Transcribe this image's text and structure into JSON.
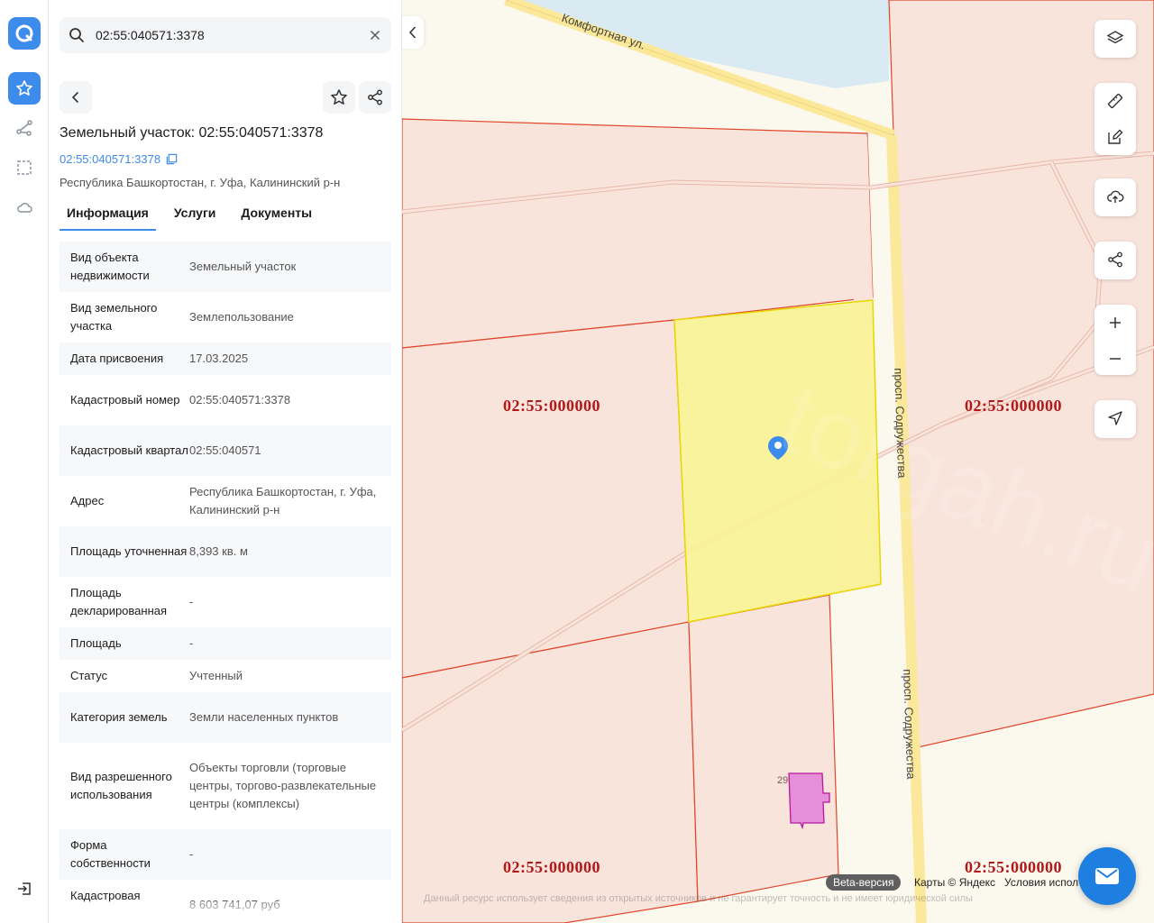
{
  "rail": {
    "items": [
      {
        "name": "favorites",
        "icon": "star-icon",
        "active": true
      },
      {
        "name": "route",
        "icon": "route-icon",
        "active": false
      },
      {
        "name": "select-area",
        "icon": "selection-icon",
        "active": false
      },
      {
        "name": "cloud",
        "icon": "cloud-icon",
        "active": false
      }
    ],
    "accent": "#3d8bea"
  },
  "search": {
    "value": "02:55:040571:3378"
  },
  "object": {
    "title": "Земельный участок: 02:55:040571:3378",
    "cad_link": "02:55:040571:3378",
    "address": "Республика Башкортостан, г. Уфа, Калининский р-н"
  },
  "tabs": [
    {
      "label": "Информация",
      "active": true
    },
    {
      "label": "Услуги",
      "active": false
    },
    {
      "label": "Документы",
      "active": false
    }
  ],
  "info_rows": [
    {
      "key": "Вид объекта недвижимости",
      "value": "Земельный участок"
    },
    {
      "key": "Вид земельного участка",
      "value": "Землепользование"
    },
    {
      "key": "Дата присвоения",
      "value": "17.03.2025"
    },
    {
      "key": "Кадастровый номер",
      "value": "02:55:040571:3378"
    },
    {
      "key": "Кадастровый квартал",
      "value": "02:55:040571"
    },
    {
      "key": "Адрес",
      "value": "Республика Башкортостан, г. Уфа, Калининский р-н"
    },
    {
      "key": "Площадь уточненная",
      "value": "8,393 кв. м"
    },
    {
      "key": "Площадь декларированная",
      "value": "-"
    },
    {
      "key": "Площадь",
      "value": "-"
    },
    {
      "key": "Статус",
      "value": "Учтенный"
    },
    {
      "key": "Категория земель",
      "value": "Земли населенных пунктов"
    },
    {
      "key": "Вид разрешенного использования",
      "value": "Объекты торговли (торговые центры, торгово-развлекательные центры (комплексы)"
    },
    {
      "key": "Форма собственности",
      "value": "-"
    },
    {
      "key": "Кадастровая",
      "value": "8 603 741,07 руб"
    }
  ],
  "map": {
    "cad_labels": [
      "02:55:000000",
      "02:55:000000",
      "02:55:000000",
      "02:55:000000"
    ],
    "streets": [
      "Комфортная ул.",
      "просп. Содружества",
      "просп. Содружества"
    ],
    "building_number": "29",
    "watermark": "torgah.ru",
    "beta_label": "Beta-версия",
    "copyright": "Карты © Яндекс",
    "terms": "Условия испол",
    "disclaimer": "Данный ресурс использует сведения из открытых источников и не гарантирует точность и не имеет юридической силы",
    "colors": {
      "parcel_fill": "#f9e4dc",
      "parcel_stroke": "#e0452a",
      "selected_fill": "#f9f296",
      "selected_stroke": "#e8d800",
      "building_fill": "#e48fd8",
      "road": "#fbe89a",
      "water": "#d9eaf2"
    }
  },
  "map_controls": [
    "layers-icon",
    "ruler-icon",
    "edit-icon",
    "upload-icon",
    "share-icon",
    "zoom-in-icon",
    "zoom-out-icon",
    "locate-icon"
  ]
}
